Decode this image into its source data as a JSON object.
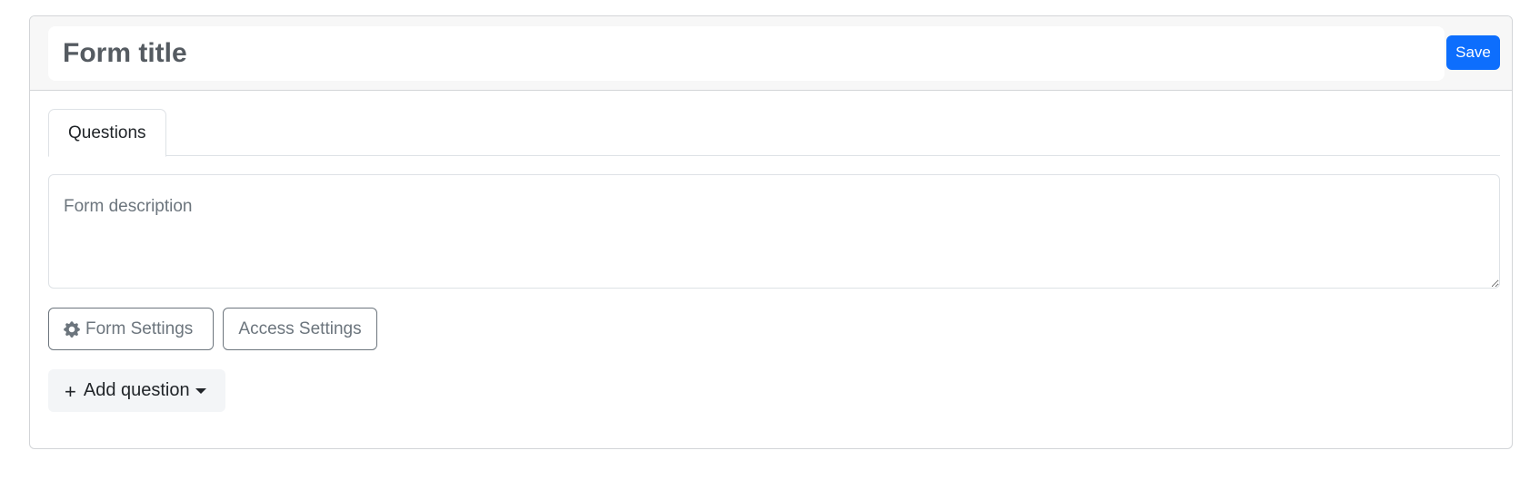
{
  "header": {
    "title_placeholder": "Form title",
    "save_label": "Save"
  },
  "tabs": [
    {
      "label": "Questions",
      "active": true
    }
  ],
  "description": {
    "placeholder": "Form description",
    "value": ""
  },
  "actions": {
    "form_settings_label": "Form Settings",
    "form_settings_icon": "gear-icon",
    "access_settings_label": "Access Settings"
  },
  "add_question": {
    "label": "Add question",
    "icon": "plus-icon",
    "dropdown_icon": "caret-down-icon"
  },
  "colors": {
    "primary": "#0d6efd",
    "secondary": "#6c757d",
    "header_bg": "#f7f7f7",
    "border": "#dee2e6"
  }
}
